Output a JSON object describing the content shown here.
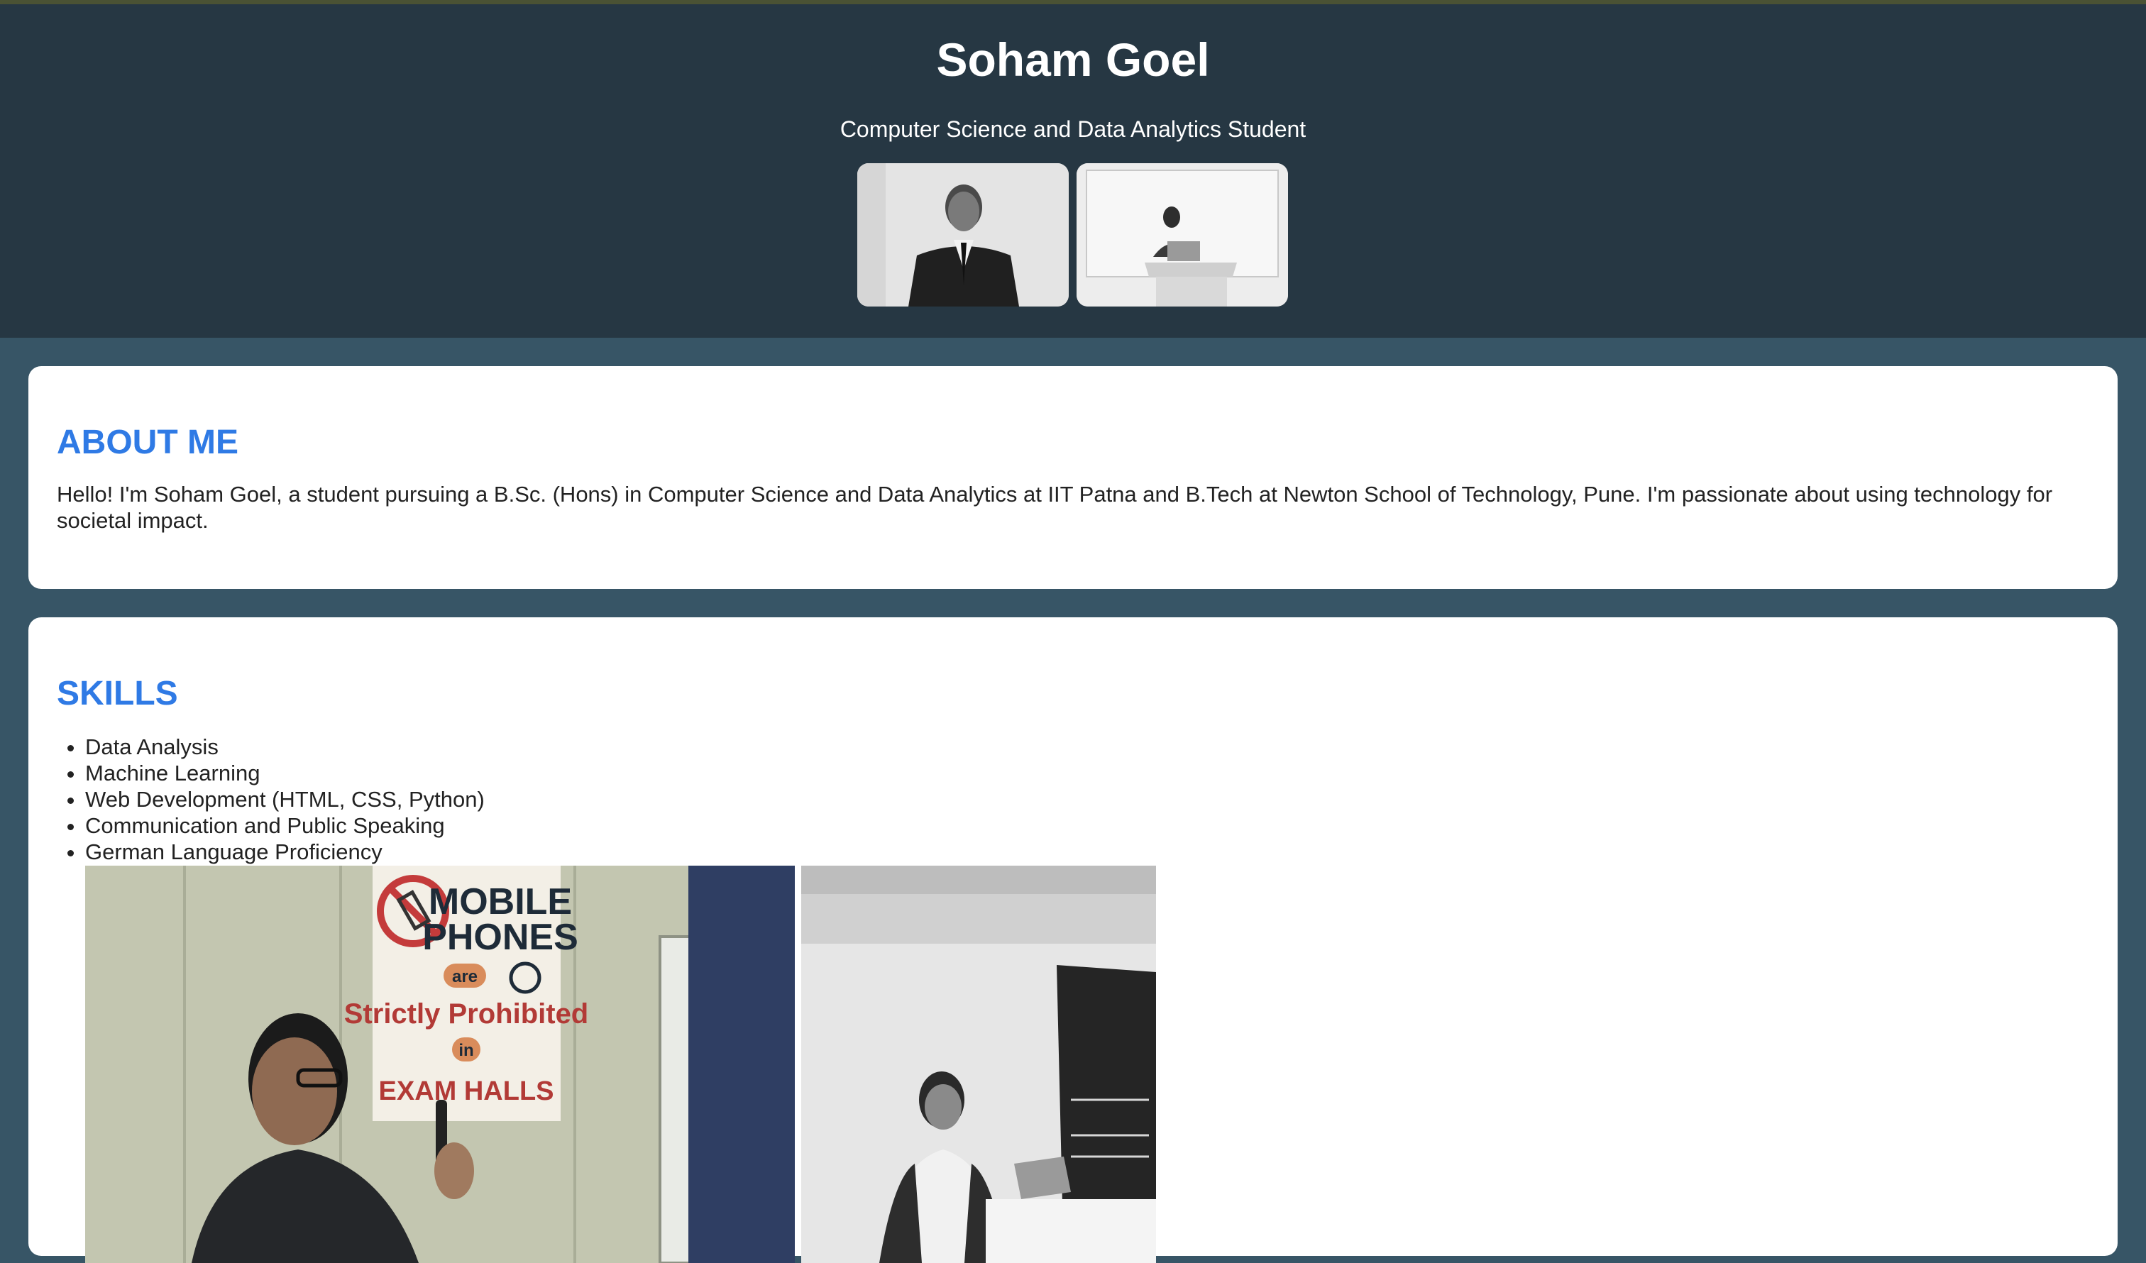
{
  "header": {
    "title": "Soham Goel",
    "subtitle": "Computer Science and Data Analytics Student"
  },
  "about": {
    "heading": "ABOUT ME",
    "text": "Hello! I'm Soham Goel, a student pursuing a B.Sc. (Hons) in Computer Science and Data Analytics at IIT Patna and B.Tech at Newton School of Technology, Pune. I'm passionate about using technology for societal impact."
  },
  "skills": {
    "heading": "SKILLS",
    "items": [
      "Data Analysis",
      "Machine Learning",
      "Web Development (HTML, CSS, Python)",
      "Communication and Public Speaking",
      "German Language Proficiency"
    ]
  },
  "photos": {
    "exam_sign": {
      "line1": "MOBILE",
      "line2": "PHONES",
      "line3": "are",
      "line4": "Strictly Prohibited",
      "line5": "in",
      "line6": "EXAM HALLS"
    }
  },
  "colors": {
    "page_bg": "#375566",
    "header_bg": "#263743",
    "heading_accent": "#2f7ae5",
    "card_bg": "#ffffff"
  }
}
